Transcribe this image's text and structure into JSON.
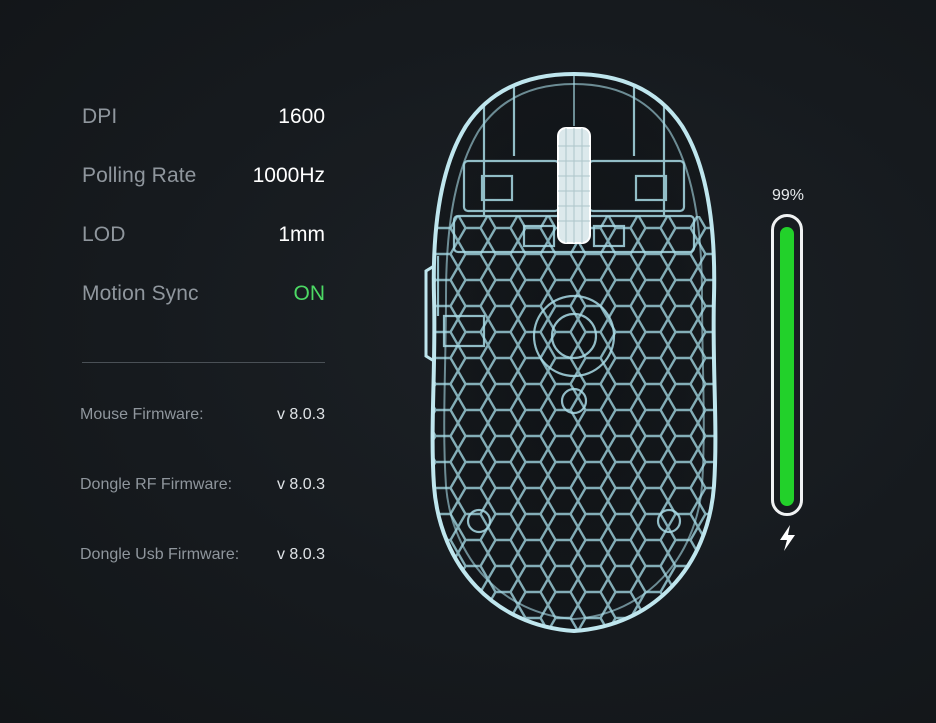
{
  "stats": [
    {
      "label": "DPI",
      "value": "1600",
      "key": "dpi"
    },
    {
      "label": "Polling Rate",
      "value": "1000Hz",
      "key": "polling-rate"
    },
    {
      "label": "LOD",
      "value": "1mm",
      "key": "lod"
    },
    {
      "label": "Motion Sync",
      "value": "ON",
      "key": "motion-sync"
    }
  ],
  "firmware": [
    {
      "label": "Mouse Firmware:",
      "value": "v 8.0.3",
      "key": "mouse"
    },
    {
      "label": "Dongle RF Firmware:",
      "value": "v 8.0.3",
      "key": "dongle-rf"
    },
    {
      "label": "Dongle Usb Firmware:",
      "value": "v 8.0.3",
      "key": "dongle-usb"
    }
  ],
  "battery": {
    "percent_label": "99%",
    "level": 0.99,
    "charging": true,
    "fill_color": "#22d12a",
    "icon": "lightning-bolt-icon"
  },
  "colors": {
    "status_on": "#4cd964",
    "xray_line": "#a9dbe6"
  },
  "mouse_image": {
    "icon": "mouse-xray-image"
  }
}
